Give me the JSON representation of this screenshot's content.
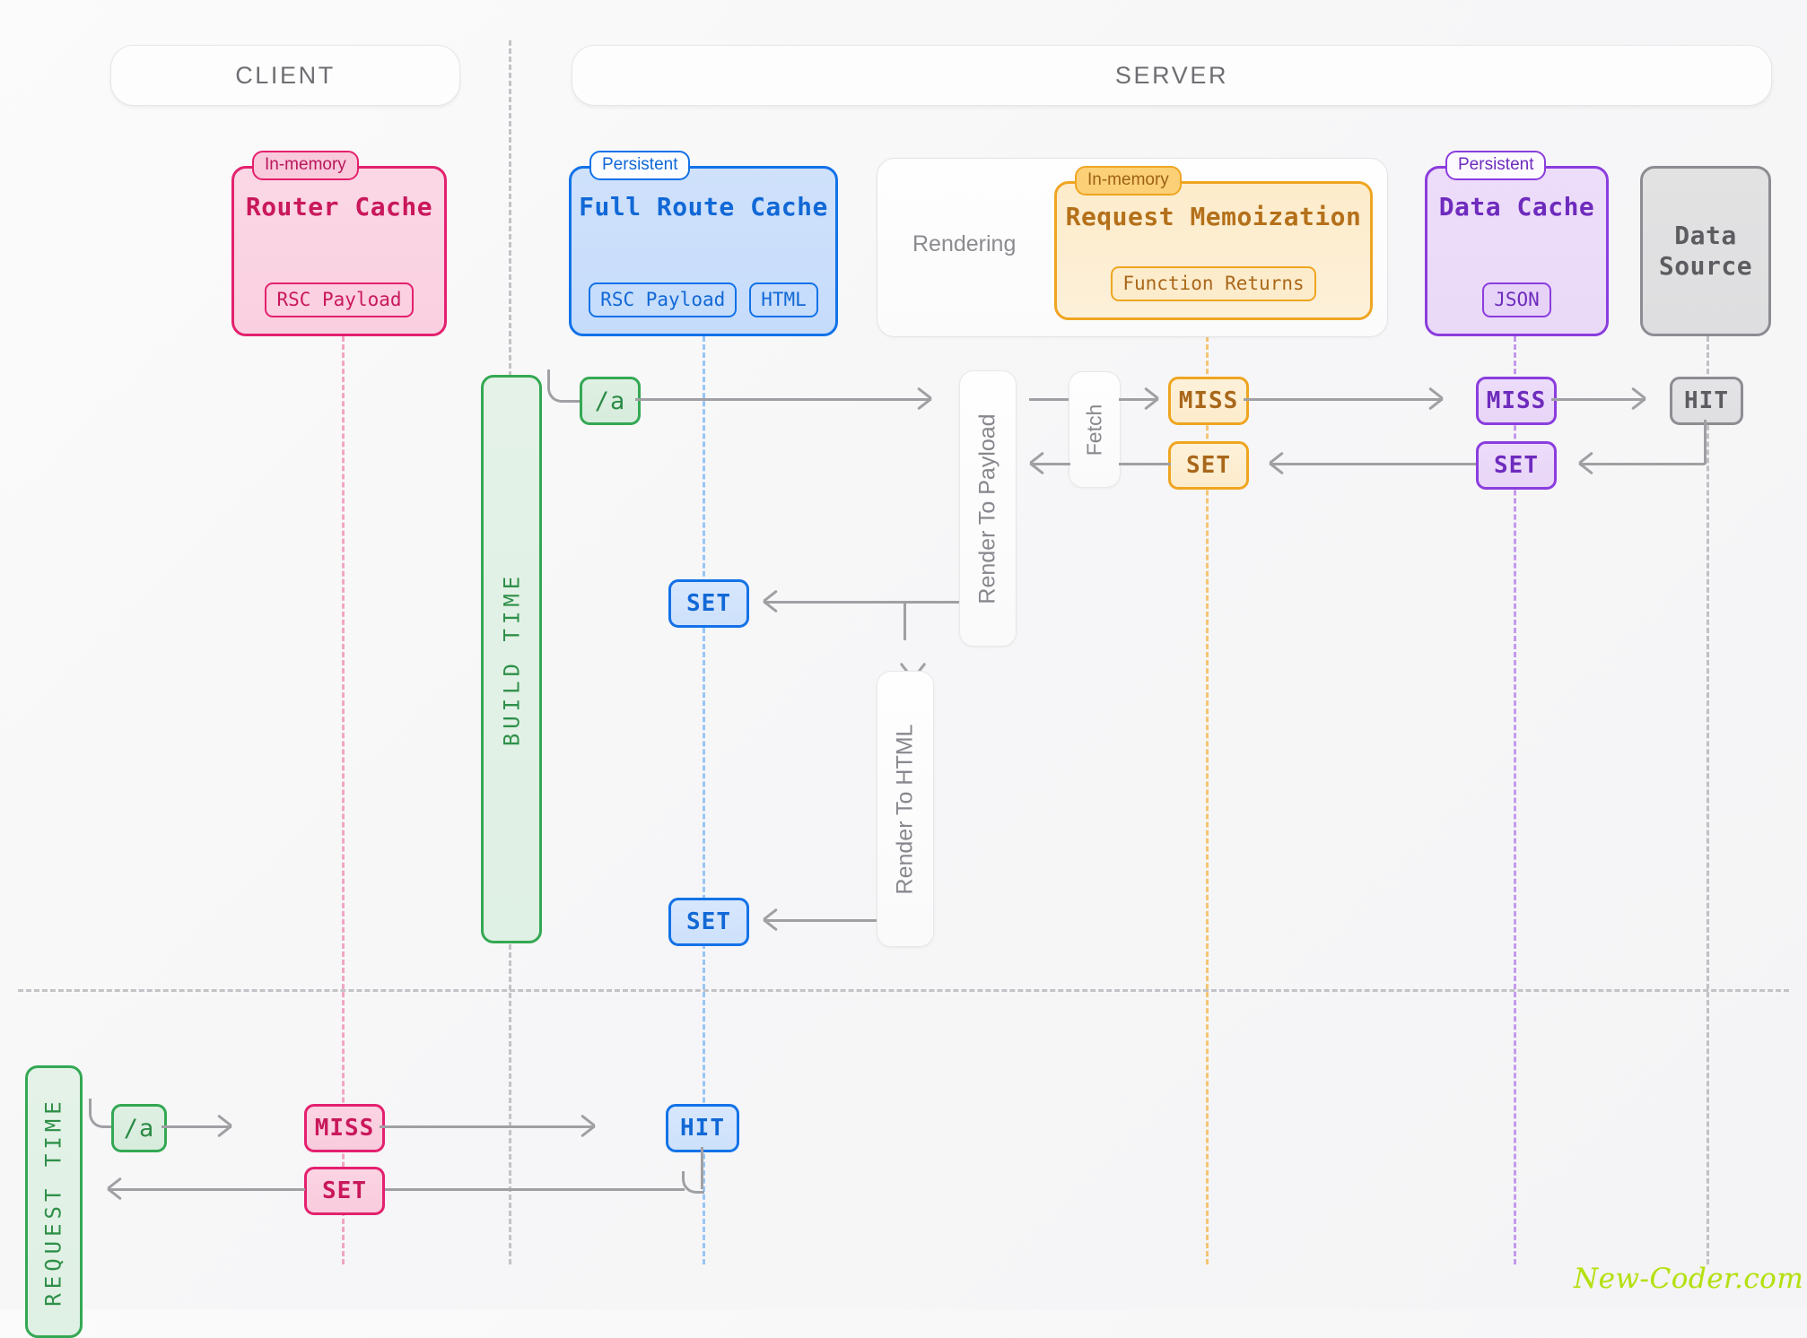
{
  "zones": {
    "client": "CLIENT",
    "server": "SERVER"
  },
  "caches": [
    {
      "id": "router-cache",
      "tag": "In-memory",
      "title": "Router Cache",
      "chips": [
        "RSC Payload"
      ],
      "color": "#e3216e"
    },
    {
      "id": "full-route-cache",
      "tag": "Persistent",
      "title": "Full Route Cache",
      "chips": [
        "RSC Payload",
        "HTML"
      ],
      "color": "#1372e8"
    },
    {
      "id": "request-memoization",
      "tag": "In-memory",
      "title": "Request Memoization",
      "chips": [
        "Function Returns"
      ],
      "color": "#efa521"
    },
    {
      "id": "data-cache",
      "tag": "Persistent",
      "title": "Data Cache",
      "chips": [
        "JSON"
      ],
      "color": "#8b3ddd"
    },
    {
      "id": "data-source",
      "tag": "",
      "title": "Data\nSource",
      "title_line1": "Data",
      "title_line2": "Source",
      "chips": [],
      "color": "#8c8c92"
    }
  ],
  "rendering": {
    "label": "Rendering"
  },
  "phases": {
    "build_time": "BUILD TIME",
    "request_time": "REQUEST TIME"
  },
  "processes": {
    "render_to_payload": "Render To Payload",
    "render_to_html": "Render To HTML",
    "fetch": "Fetch"
  },
  "build_flow": {
    "route": "/a",
    "memo_miss": "MISS",
    "memo_set": "SET",
    "data_miss": "MISS",
    "data_set": "SET",
    "source_hit": "HIT",
    "frc_set_payload": "SET",
    "frc_set_html": "SET"
  },
  "request_flow": {
    "route": "/a",
    "router_miss": "MISS",
    "router_set": "SET",
    "frc_hit": "HIT"
  },
  "watermark": "New-Coder.com",
  "colors": {
    "pink": "#e3216e",
    "blue": "#1372e8",
    "orange": "#efa521",
    "purple": "#8b3ddd",
    "grey": "#8c8c92",
    "green": "#34a853",
    "line": "#a0a0a4"
  }
}
